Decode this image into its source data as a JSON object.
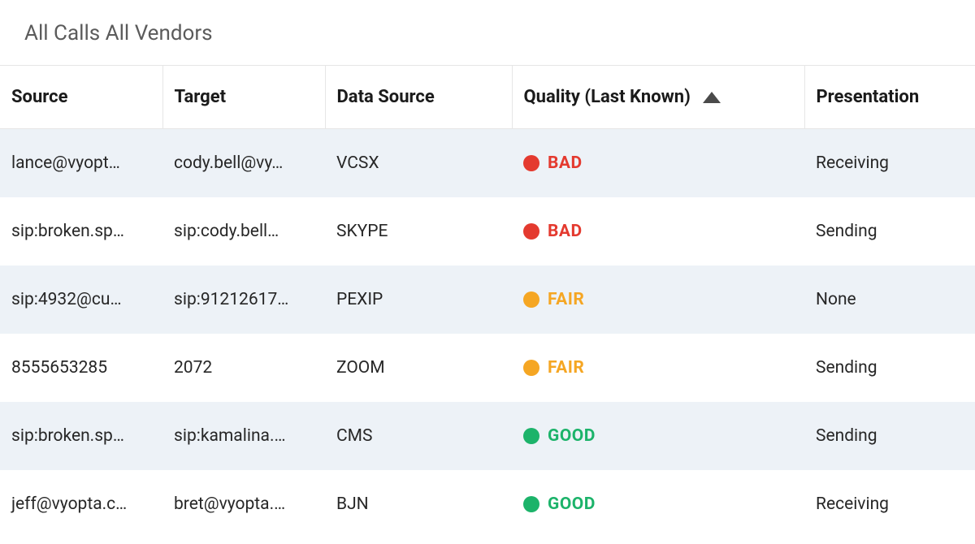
{
  "title": "All Calls All Vendors",
  "columns": {
    "source": "Source",
    "target": "Target",
    "data": "Data Source",
    "quality": "Quality (Last Known)",
    "pres": "Presentation"
  },
  "sorted_column": "quality",
  "sort_direction": "asc",
  "quality_colors": {
    "BAD": "#e43a2f",
    "FAIR": "#f5a623",
    "GOOD": "#1cb36a"
  },
  "rows": [
    {
      "source": "lance@vyopt…",
      "target": "cody.bell@vy…",
      "data": "VCSX",
      "quality": "BAD",
      "presentation": "Receiving"
    },
    {
      "source": "sip:broken.sp…",
      "target": "sip:cody.bell…",
      "data": "SKYPE",
      "quality": "BAD",
      "presentation": "Sending"
    },
    {
      "source": "sip:4932@cu…",
      "target": "sip:91212617…",
      "data": "PEXIP",
      "quality": "FAIR",
      "presentation": "None"
    },
    {
      "source": "8555653285",
      "target": "2072",
      "data": "ZOOM",
      "quality": "FAIR",
      "presentation": "Sending"
    },
    {
      "source": "sip:broken.sp…",
      "target": "sip:kamalina.…",
      "data": "CMS",
      "quality": "GOOD",
      "presentation": "Sending"
    },
    {
      "source": "jeff@vyopta.c…",
      "target": "bret@vyopta.…",
      "data": "BJN",
      "quality": "GOOD",
      "presentation": "Receiving"
    }
  ]
}
